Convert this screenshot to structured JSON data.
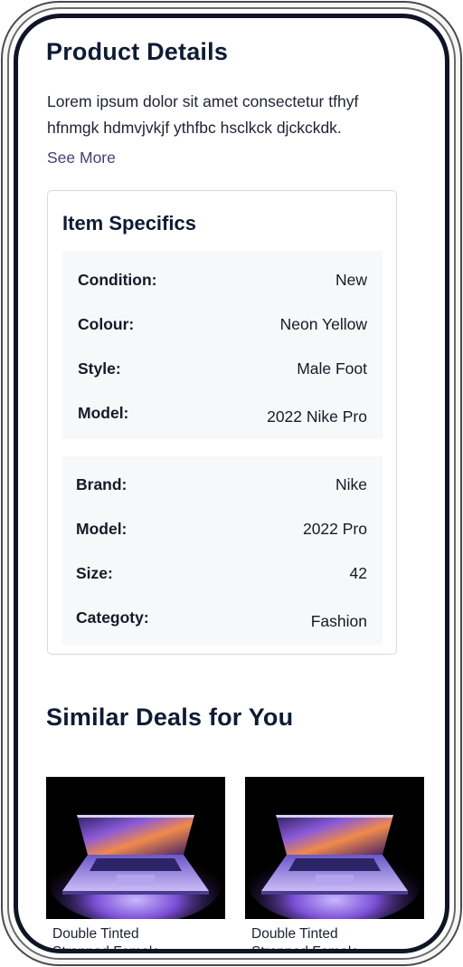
{
  "product": {
    "title": "Product Details",
    "description": "Lorem ipsum dolor sit amet consectetur tfhyf hfnmgk hdmvjvkjf ythfbc hsclkck djckckdk.",
    "see_more": "See More"
  },
  "specifics": {
    "title": "Item Specifics",
    "group1": [
      {
        "key": "Condition:",
        "value": "New"
      },
      {
        "key": "Colour:",
        "value": "Neon Yellow"
      },
      {
        "key": "Style:",
        "value": "Male Foot"
      },
      {
        "key": "Model:",
        "value": "2022 Nike Pro"
      }
    ],
    "group2": [
      {
        "key": "Brand:",
        "value": "Nike"
      },
      {
        "key": "Model:",
        "value": "2022 Pro"
      },
      {
        "key": "Size:",
        "value": "42"
      },
      {
        "key": "Categoty:",
        "value": "Fashion"
      }
    ]
  },
  "similar": {
    "title": "Similar Deals for You",
    "deals": [
      {
        "name_line1": "Double Tinted",
        "name_line2": "Strapped  Female..."
      },
      {
        "name_line1": "Double Tinted",
        "name_line2": "Strapped  Female..."
      }
    ]
  },
  "colors": {
    "heading": "#0e1b33",
    "link": "#4a3b73",
    "spec_bg": "#f6f8f9",
    "frame": "#0f1524"
  }
}
